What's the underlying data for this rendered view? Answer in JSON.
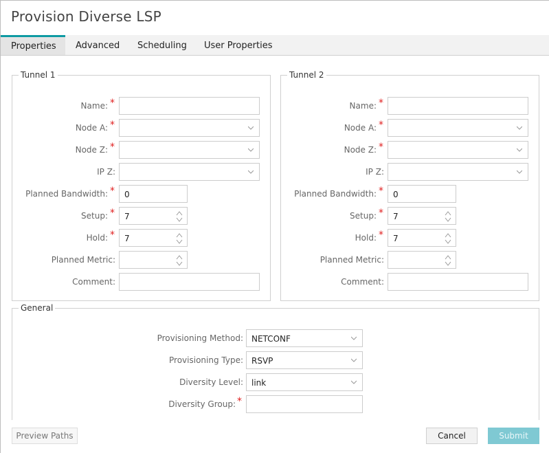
{
  "window": {
    "title": "Provision Diverse LSP"
  },
  "tabs": [
    {
      "label": "Properties",
      "active": true
    },
    {
      "label": "Advanced",
      "active": false
    },
    {
      "label": "Scheduling",
      "active": false
    },
    {
      "label": "User Properties",
      "active": false
    }
  ],
  "tunnel1": {
    "legend": "Tunnel 1",
    "name_label": "Name:",
    "name_value": "",
    "node_a_label": "Node A:",
    "node_a_value": "",
    "node_z_label": "Node Z:",
    "node_z_value": "",
    "ip_z_label": "IP Z:",
    "ip_z_value": "",
    "bandwidth_label": "Planned Bandwidth:",
    "bandwidth_value": "0",
    "setup_label": "Setup:",
    "setup_value": "7",
    "hold_label": "Hold:",
    "hold_value": "7",
    "metric_label": "Planned Metric:",
    "metric_value": "",
    "comment_label": "Comment:",
    "comment_value": ""
  },
  "tunnel2": {
    "legend": "Tunnel 2",
    "name_label": "Name:",
    "name_value": "",
    "node_a_label": "Node A:",
    "node_a_value": "",
    "node_z_label": "Node Z:",
    "node_z_value": "",
    "ip_z_label": "IP Z:",
    "ip_z_value": "",
    "bandwidth_label": "Planned Bandwidth:",
    "bandwidth_value": "0",
    "setup_label": "Setup:",
    "setup_value": "7",
    "hold_label": "Hold:",
    "hold_value": "7",
    "metric_label": "Planned Metric:",
    "metric_value": "",
    "comment_label": "Comment:",
    "comment_value": ""
  },
  "general": {
    "legend": "General",
    "method_label": "Provisioning Method:",
    "method_value": "NETCONF",
    "type_label": "Provisioning Type:",
    "type_value": "RSVP",
    "level_label": "Diversity Level:",
    "level_value": "link",
    "group_label": "Diversity Group:",
    "group_value": ""
  },
  "required_marker": "*",
  "footer": {
    "preview_label": "Preview Paths",
    "cancel_label": "Cancel",
    "submit_label": "Submit"
  },
  "colors": {
    "accent": "#0e9aa3",
    "submit": "#7fc9d3",
    "required": "#e02020"
  }
}
